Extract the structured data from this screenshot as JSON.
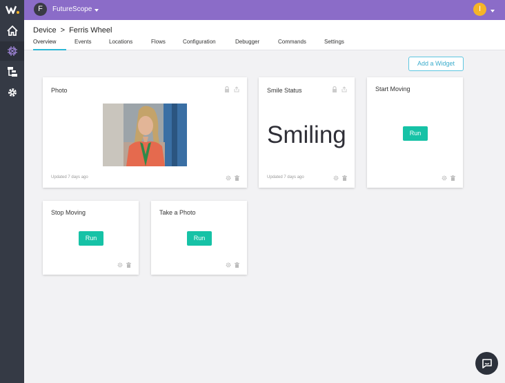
{
  "topbar": {
    "org_initial": "F",
    "org_name": "FutureScope",
    "user_initial": "I"
  },
  "breadcrumb": {
    "parent": "Device",
    "separator": ">",
    "current": "Ferris Wheel"
  },
  "tabs": [
    {
      "label": "Overview",
      "active": true
    },
    {
      "label": "Events"
    },
    {
      "label": "Locations"
    },
    {
      "label": "Flows"
    },
    {
      "label": "Configuration"
    },
    {
      "label": "Debugger"
    },
    {
      "label": "Commands"
    },
    {
      "label": "Settings"
    }
  ],
  "toolbar": {
    "add_widget_label": "Add a Widget"
  },
  "widgets": {
    "photo": {
      "title": "Photo",
      "updated": "Updated 7 days ago"
    },
    "smile": {
      "title": "Smile Status",
      "value": "Smiling",
      "updated": "Updated 7 days ago"
    },
    "start": {
      "title": "Start Moving",
      "run_label": "Run"
    },
    "stop": {
      "title": "Stop Moving",
      "run_label": "Run"
    },
    "take_photo": {
      "title": "Take a Photo",
      "run_label": "Run"
    }
  },
  "colors": {
    "sidebar": "#353a45",
    "topbar": "#8b6cc8",
    "accent": "#2bb7d6",
    "run_button": "#16c2a6",
    "user_avatar": "#f5b428"
  },
  "icons": [
    "losant-logo-icon",
    "home-icon",
    "device-icon",
    "workflow-icon",
    "gear-icon",
    "lock-icon",
    "share-icon",
    "settings-icon",
    "trash-icon",
    "chat-icon"
  ]
}
